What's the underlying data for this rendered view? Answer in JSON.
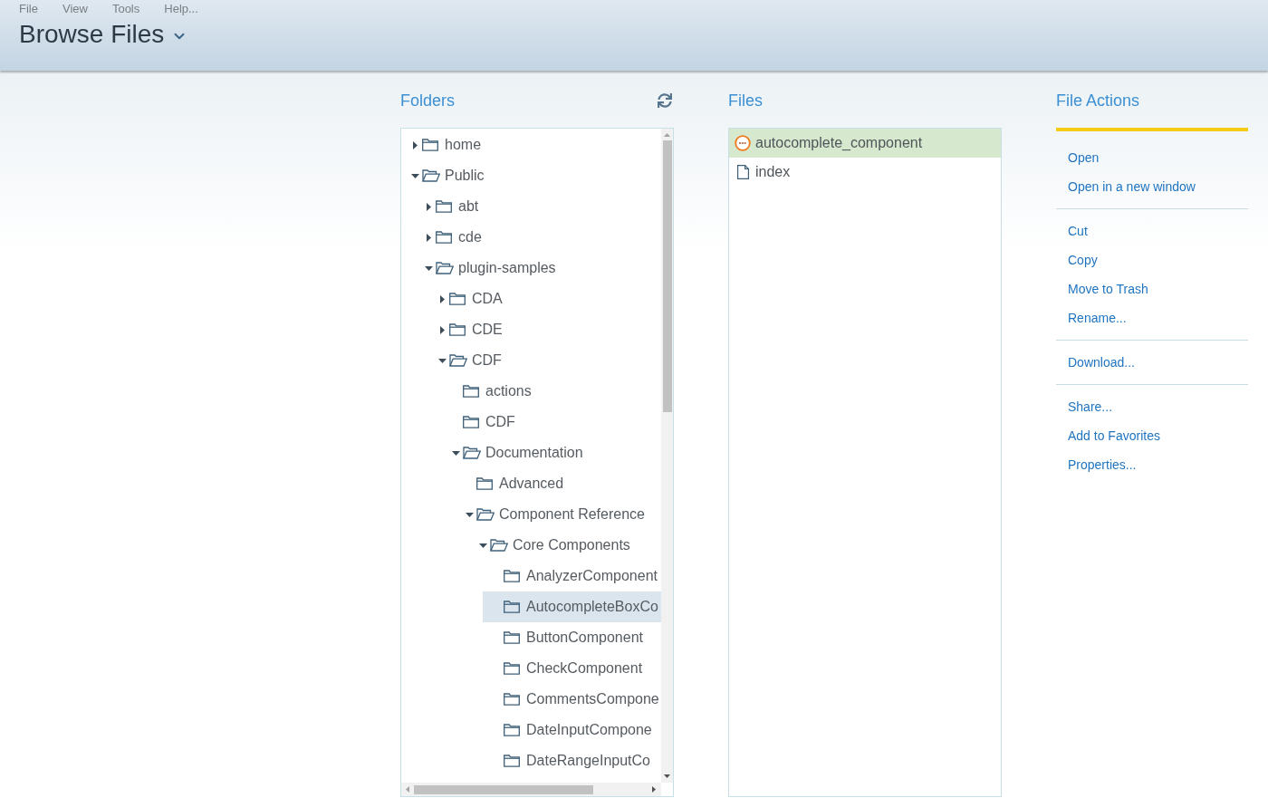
{
  "menu": [
    "File",
    "View",
    "Tools",
    "Help..."
  ],
  "page_title": "Browse Files",
  "folders": {
    "title": "Folders",
    "tree": [
      {
        "name": "home",
        "expandable": true,
        "expanded": false,
        "selected": false
      },
      {
        "name": "Public",
        "expandable": true,
        "expanded": true,
        "selected": false,
        "children": [
          {
            "name": "abt",
            "expandable": true,
            "expanded": false,
            "selected": false
          },
          {
            "name": "cde",
            "expandable": true,
            "expanded": false,
            "selected": false
          },
          {
            "name": "plugin-samples",
            "expandable": true,
            "expanded": true,
            "selected": false,
            "children": [
              {
                "name": "CDA",
                "expandable": true,
                "expanded": false,
                "selected": false
              },
              {
                "name": "CDE",
                "expandable": true,
                "expanded": false,
                "selected": false
              },
              {
                "name": "CDF",
                "expandable": true,
                "expanded": true,
                "selected": false,
                "children": [
                  {
                    "name": "actions",
                    "expandable": false,
                    "expanded": false,
                    "selected": false
                  },
                  {
                    "name": "CDF",
                    "expandable": false,
                    "expanded": false,
                    "selected": false
                  },
                  {
                    "name": "Documentation",
                    "expandable": true,
                    "expanded": true,
                    "selected": false,
                    "children": [
                      {
                        "name": "Advanced",
                        "expandable": false,
                        "expanded": false,
                        "selected": false
                      },
                      {
                        "name": "Component Reference",
                        "expandable": true,
                        "expanded": true,
                        "selected": false,
                        "children": [
                          {
                            "name": "Core Components",
                            "expandable": true,
                            "expanded": true,
                            "selected": false,
                            "children": [
                              {
                                "name": "AnalyzerComponent",
                                "expandable": false,
                                "expanded": false,
                                "selected": false
                              },
                              {
                                "name": "AutocompleteBoxCo",
                                "expandable": false,
                                "expanded": false,
                                "selected": true
                              },
                              {
                                "name": "ButtonComponent",
                                "expandable": false,
                                "expanded": false,
                                "selected": false
                              },
                              {
                                "name": "CheckComponent",
                                "expandable": false,
                                "expanded": false,
                                "selected": false
                              },
                              {
                                "name": "CommentsCompone",
                                "expandable": false,
                                "expanded": false,
                                "selected": false
                              },
                              {
                                "name": "DateInputCompone",
                                "expandable": false,
                                "expanded": false,
                                "selected": false
                              },
                              {
                                "name": "DateRangeInputCo",
                                "expandable": false,
                                "expanded": false,
                                "selected": false
                              }
                            ]
                          }
                        ]
                      }
                    ]
                  }
                ]
              }
            ]
          }
        ]
      }
    ]
  },
  "files": {
    "title": "Files",
    "items": [
      {
        "name": "autocomplete_component",
        "kind": "cdf",
        "selected": true
      },
      {
        "name": "index",
        "kind": "document",
        "selected": false
      }
    ]
  },
  "file_actions": {
    "title": "File Actions",
    "groups": [
      [
        "Open",
        "Open in a new window"
      ],
      [
        "Cut",
        "Copy",
        "Move to Trash",
        "Rename..."
      ],
      [
        "Download..."
      ],
      [
        "Share...",
        "Add to Favorites",
        "Properties..."
      ]
    ]
  }
}
